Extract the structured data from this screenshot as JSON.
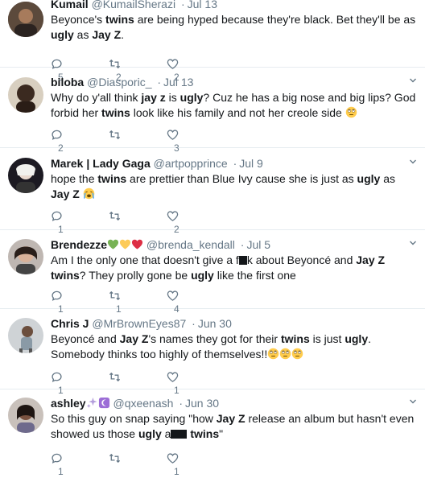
{
  "tweets": [
    {
      "name": "Kumail",
      "handle": "@KumailSherazi",
      "sep": "·",
      "time": "Jul 13",
      "segments": [
        {
          "t": "Beyonce's "
        },
        {
          "t": "twins",
          "b": true
        },
        {
          "t": " are being hyped because they're black. Bet they'll be as "
        },
        {
          "t": "ugly",
          "b": true
        },
        {
          "t": " as "
        },
        {
          "t": "Jay Z",
          "b": true
        },
        {
          "t": "."
        }
      ],
      "replies": "5",
      "retweets": "2",
      "likes": "2"
    },
    {
      "name": "biloba",
      "handle": "@Diasporic_",
      "sep": "·",
      "time": "Jul 13",
      "segments": [
        {
          "t": "Why do y'all think "
        },
        {
          "t": "jay z",
          "b": true
        },
        {
          "t": " is "
        },
        {
          "t": "ugly",
          "b": true
        },
        {
          "t": "? Cuz he has a big nose and big lips? God forbid her "
        },
        {
          "t": "twins",
          "b": true
        },
        {
          "t": " look like his family and not her creole side "
        },
        {
          "emoji": "rolling-eyes"
        }
      ],
      "replies": "2",
      "retweets": "",
      "likes": "3"
    },
    {
      "name": "Marek | Lady Gaga",
      "handle": "@artpopprince",
      "sep": "·",
      "time": "Jul 9",
      "segments": [
        {
          "t": "hope the "
        },
        {
          "t": "twins",
          "b": true
        },
        {
          "t": " are prettier than Blue Ivy cause she is just as "
        },
        {
          "t": "ugly",
          "b": true
        },
        {
          "t": " as "
        },
        {
          "t": "Jay Z",
          "b": true
        },
        {
          "t": " "
        },
        {
          "emoji": "crying"
        }
      ],
      "replies": "1",
      "retweets": "",
      "likes": "2"
    },
    {
      "name": "Brendezze",
      "name_emoji": [
        "green-heart",
        "yellow-heart",
        "red-heart"
      ],
      "handle": "@brenda_kendall",
      "sep": "·",
      "time": "Jul 5",
      "segments": [
        {
          "t": "Am I the only one that doesn't give a f"
        },
        {
          "redact": true
        },
        {
          "t": "k about Beyoncé and "
        },
        {
          "t": "Jay Z",
          "b": true
        },
        {
          "t": " "
        },
        {
          "t": "twins",
          "b": true
        },
        {
          "t": "? They prolly gone be "
        },
        {
          "t": "ugly",
          "b": true
        },
        {
          "t": " like the first one"
        }
      ],
      "replies": "1",
      "retweets": "1",
      "likes": "4"
    },
    {
      "name": "Chris J",
      "handle": "@MrBrownEyes87",
      "sep": "·",
      "time": "Jun 30",
      "segments": [
        {
          "t": "Beyoncé and "
        },
        {
          "t": "Jay Z",
          "b": true
        },
        {
          "t": "'s names they got for their "
        },
        {
          "t": "twins",
          "b": true
        },
        {
          "t": " is just "
        },
        {
          "t": "ugly",
          "b": true
        },
        {
          "t": ". Somebody thinks too highly of themselves!!"
        },
        {
          "emoji": "rolling-eyes"
        },
        {
          "emoji": "rolling-eyes"
        },
        {
          "emoji": "rolling-eyes"
        }
      ],
      "replies": "1",
      "retweets": "",
      "likes": "1"
    },
    {
      "name": "ashley",
      "name_emoji": [
        "sparkles",
        "crescent"
      ],
      "handle": "@qxeenash",
      "sep": "·",
      "time": "Jun 30",
      "segments": [
        {
          "t": "So this guy on snap saying \"how "
        },
        {
          "t": "Jay Z",
          "b": true
        },
        {
          "t": " release an album but hasn't even showed us those "
        },
        {
          "t": "ugly",
          "b": true
        },
        {
          "t": " a"
        },
        {
          "redact": true
        },
        {
          "redact": true
        },
        {
          "t": " "
        },
        {
          "t": "twins",
          "b": true
        },
        {
          "t": "\""
        }
      ],
      "replies": "1",
      "retweets": "",
      "likes": "1"
    }
  ]
}
